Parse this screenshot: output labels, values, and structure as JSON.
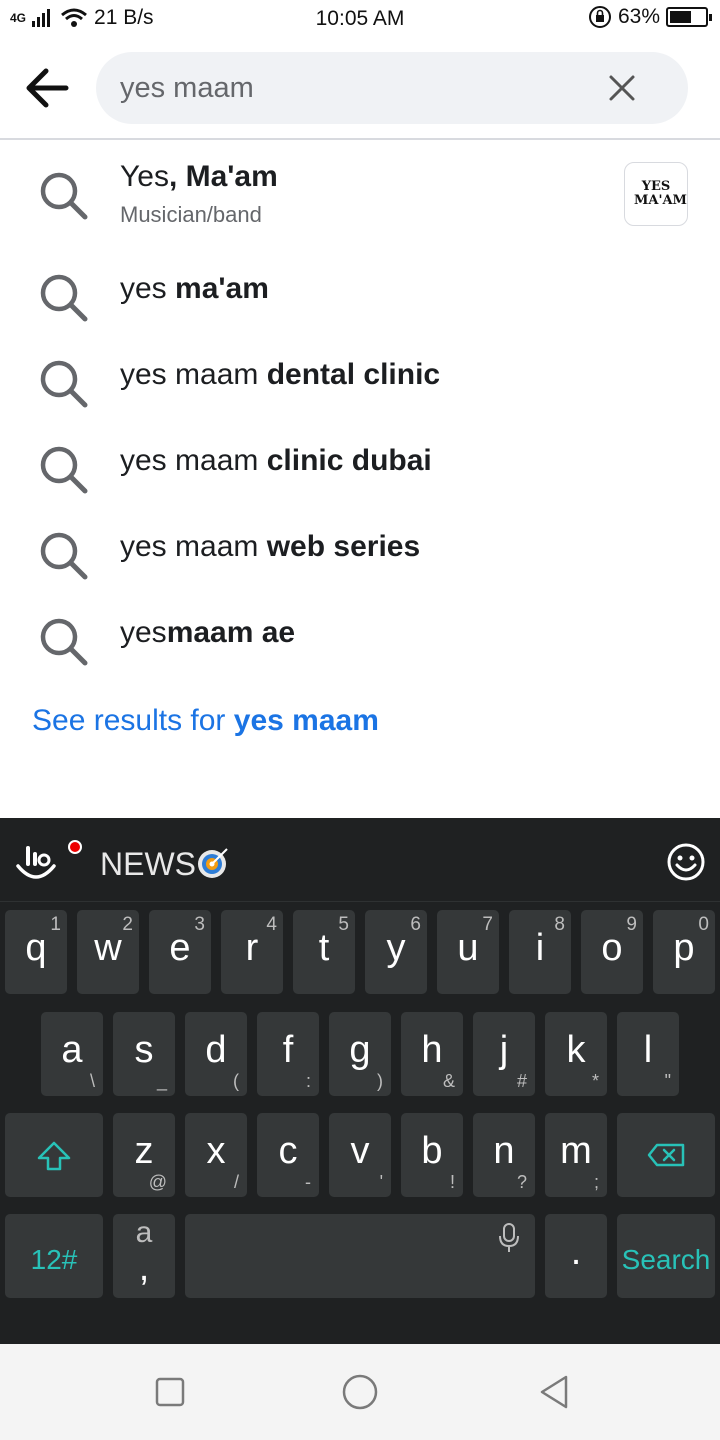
{
  "status": {
    "network": "4G",
    "speed": "21 B/s",
    "time": "10:05 AM",
    "battery": "63%",
    "battery_level": 0.63
  },
  "search": {
    "query": "yes maam",
    "placeholder": ""
  },
  "suggestions": [
    {
      "prefix": "Yes",
      "bold": ", Ma'am",
      "subtitle": "Musician/band",
      "thumb_text": "YES MA'AM"
    },
    {
      "prefix": "yes ",
      "bold": "ma'am"
    },
    {
      "prefix": "yes maam ",
      "bold": "dental clinic"
    },
    {
      "prefix": "yes maam ",
      "bold": "clinic dubai"
    },
    {
      "prefix": "yes maam ",
      "bold": "web series"
    },
    {
      "prefix": "yes",
      "bold": "maam ae"
    }
  ],
  "see_results": {
    "prefix": "See results for ",
    "query": "yes maam"
  },
  "keyboard": {
    "banner": "NEWS",
    "row1": [
      {
        "k": "q",
        "n": "1"
      },
      {
        "k": "w",
        "n": "2"
      },
      {
        "k": "e",
        "n": "3"
      },
      {
        "k": "r",
        "n": "4"
      },
      {
        "k": "t",
        "n": "5"
      },
      {
        "k": "y",
        "n": "6"
      },
      {
        "k": "u",
        "n": "7"
      },
      {
        "k": "i",
        "n": "8"
      },
      {
        "k": "o",
        "n": "9"
      },
      {
        "k": "p",
        "n": "0"
      }
    ],
    "row2": [
      {
        "k": "a",
        "s": "\\"
      },
      {
        "k": "s",
        "s": "_"
      },
      {
        "k": "d",
        "s": "("
      },
      {
        "k": "f",
        "s": ":"
      },
      {
        "k": "g",
        "s": ")"
      },
      {
        "k": "h",
        "s": "&"
      },
      {
        "k": "j",
        "s": "#"
      },
      {
        "k": "k",
        "s": "*"
      },
      {
        "k": "l",
        "s": "\""
      }
    ],
    "row3": [
      {
        "k": "z",
        "s": "@"
      },
      {
        "k": "x",
        "s": "/"
      },
      {
        "k": "c",
        "s": "-"
      },
      {
        "k": "v",
        "s": "'"
      },
      {
        "k": "b",
        "s": "!"
      },
      {
        "k": "n",
        "s": "?"
      },
      {
        "k": "m",
        "s": ";"
      }
    ],
    "numbers_key": "12#",
    "comma_key_top": "a",
    "comma_key": ",",
    "period_key": ".",
    "search_key": "Search"
  }
}
